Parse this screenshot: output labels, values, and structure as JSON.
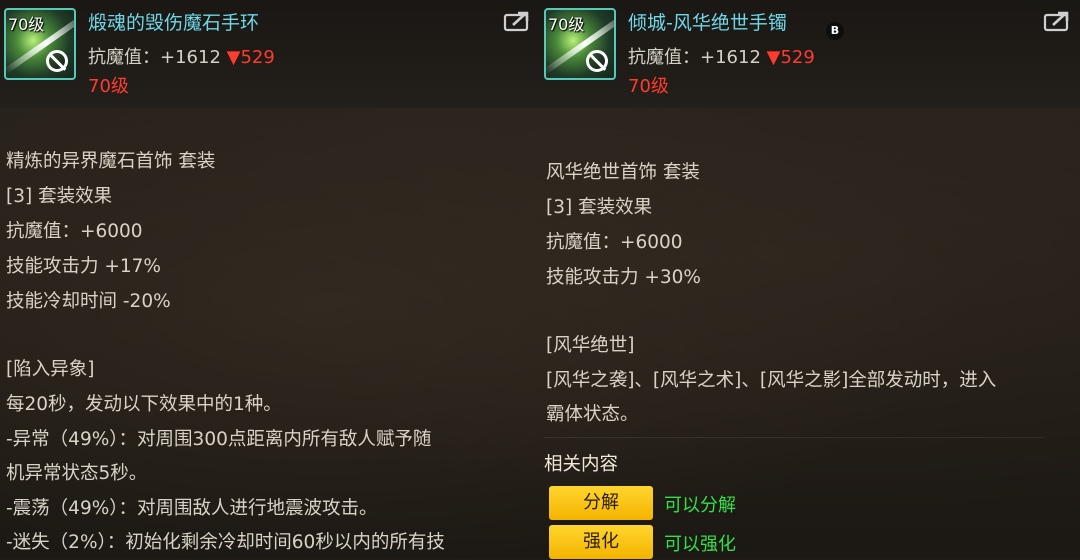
{
  "left": {
    "level_badge": "70级",
    "name": "煅魂的毁伤魔石手环",
    "stat_label": "抗魔值：+1612",
    "stat_delta": "▼529",
    "level_req": "70级",
    "lines": [
      "精炼的异界魔石首饰 套装",
      "[3] 套装效果",
      "抗魔值：+6000",
      "技能攻击力 +17%",
      "技能冷却时间 -20%",
      "",
      "[陷入异象]",
      "每20秒，发动以下效果中的1种。",
      "-异常（49%）：对周围300点距离内所有敌人赋予随",
      "机异常状态5秒。",
      "-震荡（49%）：对周围敌人进行地震波攻击。",
      "-迷失（2%）：初始化剩余冷却时间60秒以内的所有技"
    ]
  },
  "right": {
    "level_badge": "70级",
    "name": "倾城-风华绝世手镯",
    "badge": "B",
    "stat_label": "抗魔值：+1612",
    "stat_delta": "▼529",
    "level_req": "70级",
    "lines": [
      "风华绝世首饰 套装",
      "[3] 套装效果",
      "抗魔值：+6000",
      "技能攻击力 +30%",
      "",
      "[风华绝世]",
      "[风华之袭]、[风华之术]、[风华之影]全部发动时，进入",
      "霸体状态。"
    ],
    "related_title": "相关内容",
    "actions": [
      {
        "label": "分解",
        "desc": "可以分解"
      },
      {
        "label": "强化",
        "desc": "可以强化"
      }
    ]
  },
  "colors": {
    "item_name": "#6fd8e6",
    "red": "#ff3b2f",
    "button": "#ffc21a",
    "green": "#33e04a",
    "icon_border": "#58c9b8"
  },
  "icons": {
    "item": "bracelet-icon",
    "untradeable": "no-trade-icon",
    "share": "share-icon"
  }
}
